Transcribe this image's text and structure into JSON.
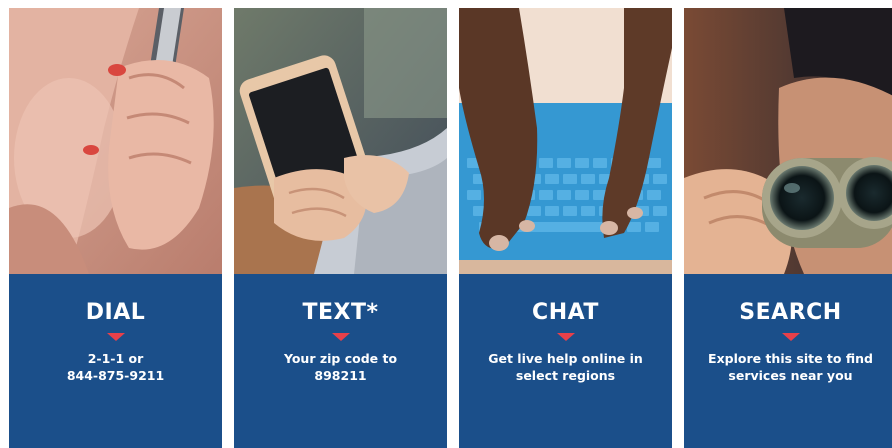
{
  "colors": {
    "panel": "#1b4f8a",
    "caret": "#e8404a",
    "text": "#ffffff"
  },
  "cards": [
    {
      "id": "dial",
      "title": "DIAL",
      "desc_lines": [
        "2-1-1 or",
        "844-875-9211"
      ],
      "photo": "person-on-phone"
    },
    {
      "id": "text",
      "title": "TEXT*",
      "desc_lines": [
        "Your zip code to",
        "898211"
      ],
      "photo": "hands-texting-on-smartphone"
    },
    {
      "id": "chat",
      "title": "CHAT",
      "desc_lines": [
        "Get live help online in",
        "select regions"
      ],
      "photo": "hands-typing-on-keyboard"
    },
    {
      "id": "search",
      "title": "SEARCH",
      "desc_lines": [
        "Explore this site to find",
        "services near you"
      ],
      "photo": "person-with-binoculars"
    }
  ]
}
